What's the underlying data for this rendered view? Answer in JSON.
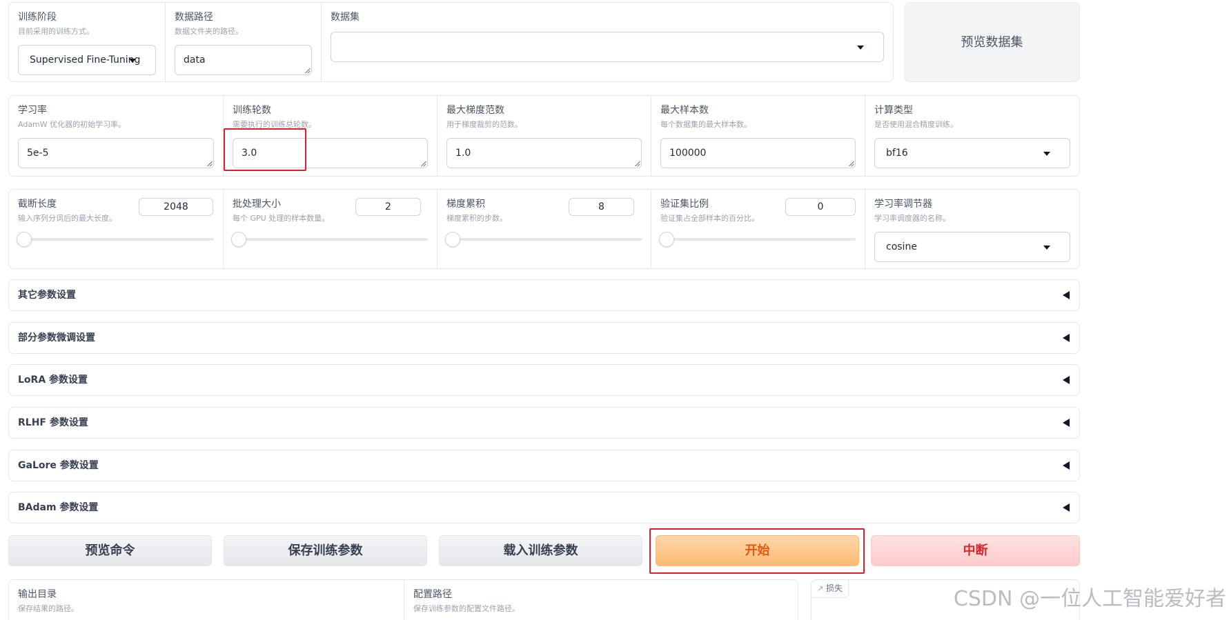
{
  "row1": {
    "stage": {
      "label": "训练阶段",
      "info": "目前采用的训练方式。",
      "value": "Supervised Fine-Tuning"
    },
    "data_dir": {
      "label": "数据路径",
      "info": "数据文件夹的路径。",
      "value": "data"
    },
    "dataset": {
      "label": "数据集",
      "value": ""
    },
    "preview_button": "预览数据集"
  },
  "row2": {
    "learning_rate": {
      "label": "学习率",
      "info": "AdamW 优化器的初始学习率。",
      "value": "5e-5"
    },
    "num_epochs": {
      "label": "训练轮数",
      "info": "需要执行的训练总轮数。",
      "value": "3.0"
    },
    "max_grad_norm": {
      "label": "最大梯度范数",
      "info": "用于梯度裁剪的范数。",
      "value": "1.0"
    },
    "max_samples": {
      "label": "最大样本数",
      "info": "每个数据集的最大样本数。",
      "value": "100000"
    },
    "compute_type": {
      "label": "计算类型",
      "info": "是否使用混合精度训练。",
      "value": "bf16"
    }
  },
  "row3": {
    "cutoff_len": {
      "label": "截断长度",
      "info": "输入序列分词后的最大长度。",
      "value": "2048",
      "slider_fraction": 0.0
    },
    "batch_size": {
      "label": "批处理大小",
      "info": "每个 GPU 处理的样本数量。",
      "value": "2",
      "slider_fraction": 0.0
    },
    "grad_accum": {
      "label": "梯度累积",
      "info": "梯度累积的步数。",
      "value": "8",
      "slider_fraction": 0.0
    },
    "val_size": {
      "label": "验证集比例",
      "info": "验证集占全部样本的百分比。",
      "value": "0",
      "slider_fraction": 0.0
    },
    "lr_scheduler": {
      "label": "学习率调节器",
      "info": "学习率调度器的名称。",
      "value": "cosine"
    }
  },
  "accordions": [
    "其它参数设置",
    "部分参数微调设置",
    "LoRA 参数设置",
    "RLHF 参数设置",
    "GaLore 参数设置",
    "BAdam 参数设置"
  ],
  "actions": {
    "preview_cmd": "预览命令",
    "save_args": "保存训练参数",
    "load_args": "载入训练参数",
    "start": "开始",
    "abort": "中断"
  },
  "bottom": {
    "output_dir": {
      "label": "输出目录",
      "info": "保存结果的路径。"
    },
    "config_path": {
      "label": "配置路径",
      "info": "保存训练参数的配置文件路径。"
    },
    "loss_tab": "损失"
  },
  "watermark": "CSDN @一位人工智能爱好者"
}
